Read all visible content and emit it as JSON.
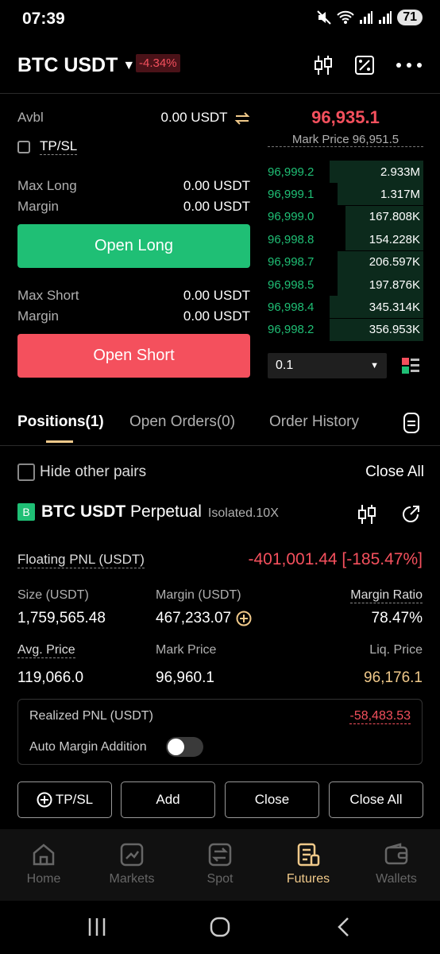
{
  "status": {
    "time": "07:39",
    "battery": "71"
  },
  "header": {
    "pair": "BTC USDT",
    "change": "-4.34%"
  },
  "trade": {
    "avbl_label": "Avbl",
    "avbl_value": "0.00 USDT",
    "tpsl_label": "TP/SL",
    "max_long_label": "Max Long",
    "max_long_value": "0.00 USDT",
    "margin_long_label": "Margin",
    "margin_long_value": "0.00 USDT",
    "open_long": "Open Long",
    "max_short_label": "Max Short",
    "max_short_value": "0.00 USDT",
    "margin_short_label": "Margin",
    "margin_short_value": "0.00 USDT",
    "open_short": "Open Short"
  },
  "orderbook": {
    "last_price": "96,935.1",
    "mark_price": "Mark Price 96,951.5",
    "rows": [
      {
        "price": "96,999.2",
        "qty": "2.933M",
        "depth": 0.6
      },
      {
        "price": "96,999.1",
        "qty": "1.317M",
        "depth": 0.55
      },
      {
        "price": "96,999.0",
        "qty": "167.808K",
        "depth": 0.5
      },
      {
        "price": "96,998.8",
        "qty": "154.228K",
        "depth": 0.5
      },
      {
        "price": "96,998.7",
        "qty": "206.597K",
        "depth": 0.55
      },
      {
        "price": "96,998.5",
        "qty": "197.876K",
        "depth": 0.55
      },
      {
        "price": "96,998.4",
        "qty": "345.314K",
        "depth": 0.6
      },
      {
        "price": "96,998.2",
        "qty": "356.953K",
        "depth": 0.6
      }
    ],
    "depth_select": "0.1"
  },
  "tabs": {
    "positions": "Positions(1)",
    "open_orders": "Open Orders(0)",
    "order_history": "Order History"
  },
  "positions_bar": {
    "hide_label": "Hide other pairs",
    "close_all": "Close All"
  },
  "position": {
    "badge": "B",
    "pair": "BTC USDT",
    "kind": "Perpetual",
    "tag": "Isolated.10X",
    "pnl_label": "Floating PNL (USDT)",
    "pnl_value": "-401,001.44 [-185.47%]",
    "size_label": "Size (USDT)",
    "size_value": "1,759,565.48",
    "margin_label": "Margin (USDT)",
    "margin_value": "467,233.07",
    "ratio_label": "Margin Ratio",
    "ratio_value": "78.47%",
    "avg_label": "Avg. Price",
    "avg_value": "119,066.0",
    "mark_label": "Mark Price",
    "mark_value": "96,960.1",
    "liq_label": "Liq. Price",
    "liq_value": "96,176.1",
    "realized_label": "Realized PNL (USDT)",
    "realized_value": "-58,483.53",
    "auto_margin_label": "Auto Margin Addition",
    "auto_margin_on": false
  },
  "actions": {
    "tpsl": "TP/SL",
    "add": "Add",
    "close": "Close",
    "close_all": "Close All"
  },
  "nav": {
    "home": "Home",
    "markets": "Markets",
    "spot": "Spot",
    "futures": "Futures",
    "wallets": "Wallets"
  },
  "colors": {
    "green": "#1fbf75",
    "red": "#f4505d",
    "accent": "#f0c98a"
  }
}
